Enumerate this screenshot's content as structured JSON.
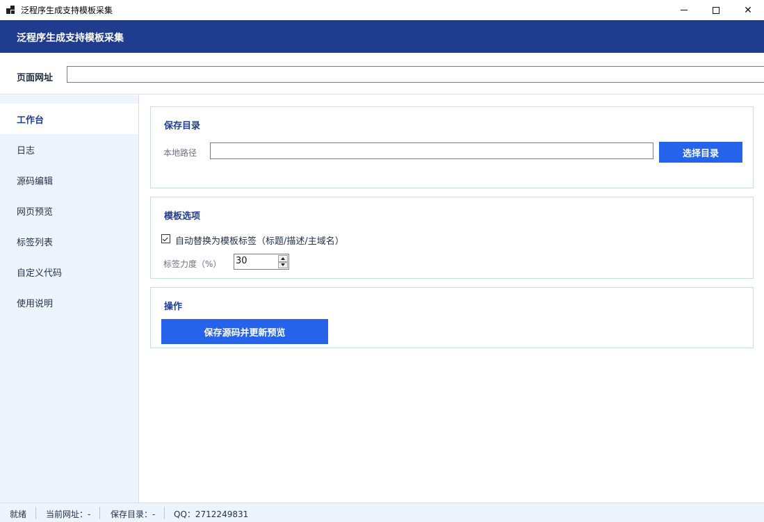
{
  "window": {
    "title": "泛程序生成支持模板采集",
    "minimize_icon": "minimize-icon",
    "maximize_icon": "maximize-icon",
    "close_icon": "close-icon",
    "close_glyph": "✕"
  },
  "header": {
    "title": "泛程序生成支持模板采集",
    "background_color": "#1f3c8f"
  },
  "url_bar": {
    "label": "页面网址",
    "value": ""
  },
  "sidebar": {
    "items": [
      {
        "label": "工作台",
        "active": true
      },
      {
        "label": "日志",
        "active": false
      },
      {
        "label": "源码编辑",
        "active": false
      },
      {
        "label": "网页预览",
        "active": false
      },
      {
        "label": "标签列表",
        "active": false
      },
      {
        "label": "自定义代码",
        "active": false
      },
      {
        "label": "使用说明",
        "active": false
      }
    ]
  },
  "save_dir": {
    "title": "保存目录",
    "path_label": "本地路径",
    "path_value": "",
    "choose_button": "选择目录"
  },
  "template_options": {
    "title": "模板选项",
    "auto_replace_label": "自动替换为模板标签（标题/描述/主域名）",
    "auto_replace_checked": true,
    "strength_label": "标签力度（%）",
    "strength_value": "30"
  },
  "operations": {
    "title": "操作",
    "save_button": "保存源码并更新预览"
  },
  "status_bar": {
    "ready": "就绪",
    "current_url": "当前网址：-",
    "save_dir": "保存目录：-",
    "qq": "QQ：2712249831"
  },
  "colors": {
    "accent": "#2563eb",
    "sidebar_bg": "#eef4fd",
    "panel_border": "#c6dbf0"
  }
}
